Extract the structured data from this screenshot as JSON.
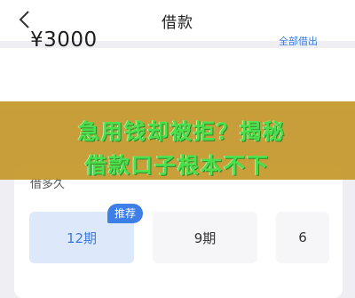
{
  "header": {
    "title": "借款",
    "back_icon": "chevron-left-icon"
  },
  "loan": {
    "amount": "¥3000",
    "borrow_all_label": "全部借出"
  },
  "banner": {
    "line1": "急用钱却被拒？揭秘",
    "line2": "借款口子根本不下"
  },
  "periods": {
    "label": "借多久",
    "recommend_badge": "推荐",
    "options": [
      "12期",
      "9期",
      "6"
    ],
    "selected_index": 0
  },
  "colors": {
    "accent": "#3a7ae0",
    "selected_bg": "#dde9fb",
    "banner_bg": "#c4982a",
    "banner_text": "#4be04b"
  }
}
